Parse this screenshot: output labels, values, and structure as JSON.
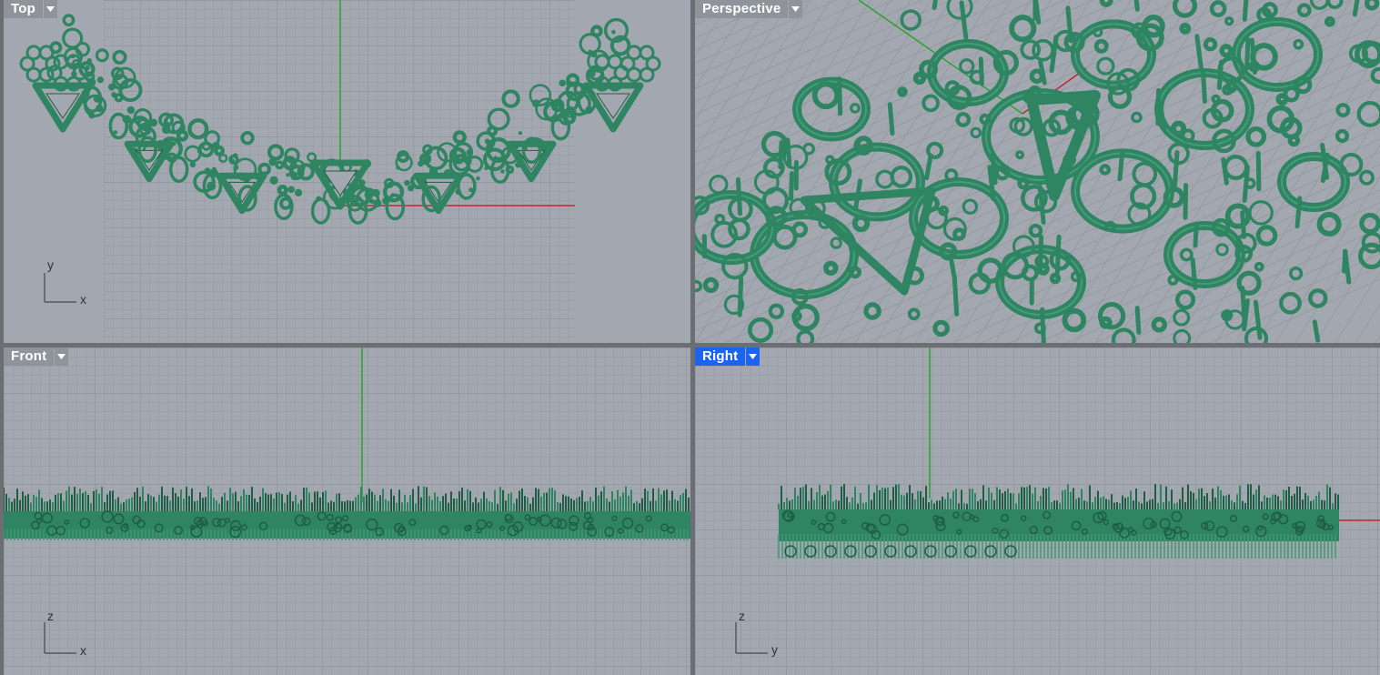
{
  "viewports": [
    {
      "id": "top",
      "label": "Top",
      "active": false,
      "axis_h": "x",
      "axis_v": "y"
    },
    {
      "id": "perspective",
      "label": "Perspective",
      "active": false
    },
    {
      "id": "front",
      "label": "Front",
      "active": false,
      "axis_h": "x",
      "axis_v": "z"
    },
    {
      "id": "right",
      "label": "Right",
      "active": true,
      "axis_h": "y",
      "axis_v": "z"
    }
  ],
  "icons": {
    "dropdown": "chevron-down-icon"
  },
  "colors": {
    "model": "#2f8462",
    "grid_bg": "#a3a8b0",
    "active_tab": "#1a64f0",
    "tab": "#8f949b",
    "x_axis": "#c0282a",
    "y_axis": "#2ea02e"
  }
}
